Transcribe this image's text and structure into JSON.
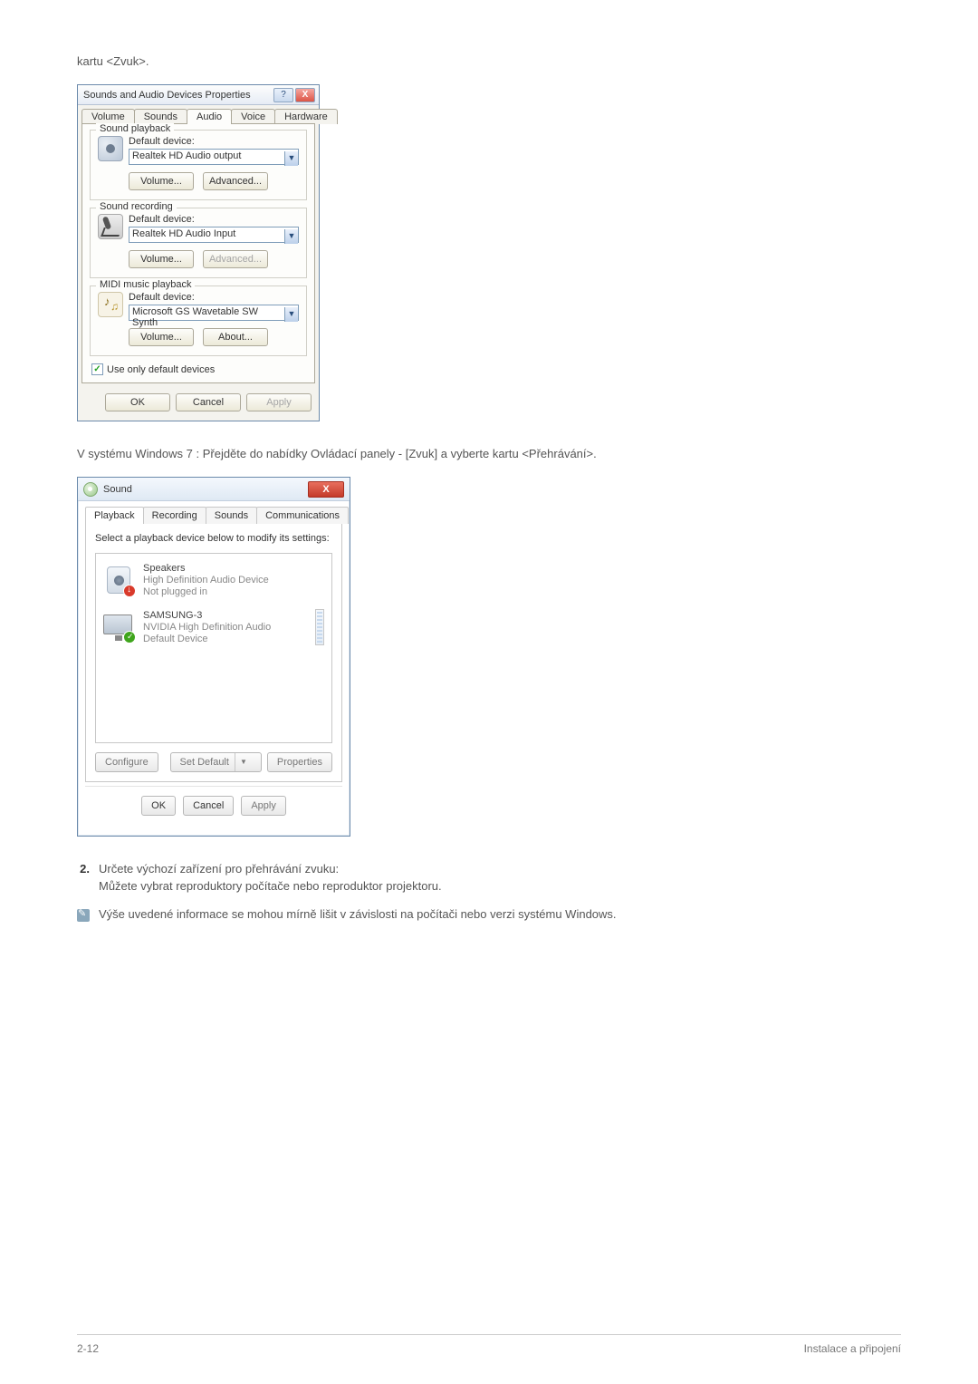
{
  "intro_text": "kartu <Zvuk>.",
  "xp": {
    "title": "Sounds and Audio Devices Properties",
    "tabs": {
      "t1": "Volume",
      "t2": "Sounds",
      "t3": "Audio",
      "t4": "Voice",
      "t5": "Hardware"
    },
    "playback": {
      "legend": "Sound playback",
      "label": "Default device:",
      "value": "Realtek HD Audio output",
      "btn_volume": "Volume...",
      "btn_advanced": "Advanced..."
    },
    "recording": {
      "legend": "Sound recording",
      "label": "Default device:",
      "value": "Realtek HD Audio Input",
      "btn_volume": "Volume...",
      "btn_advanced": "Advanced..."
    },
    "midi": {
      "legend": "MIDI music playback",
      "label": "Default device:",
      "value": "Microsoft GS Wavetable SW Synth",
      "btn_volume": "Volume...",
      "btn_about": "About..."
    },
    "checkbox": "Use only default devices",
    "btn_ok": "OK",
    "btn_cancel": "Cancel",
    "btn_apply": "Apply"
  },
  "mid_text": "V systému Windows 7 : Přejděte do nabídky Ovládací panely - [Zvuk] a vyberte kartu <Přehrávání>.",
  "w7": {
    "title": "Sound",
    "tabs": {
      "t1": "Playback",
      "t2": "Recording",
      "t3": "Sounds",
      "t4": "Communications"
    },
    "instruct": "Select a playback device below to modify its settings:",
    "dev1": {
      "name": "Speakers",
      "line2": "High Definition Audio Device",
      "line3": "Not plugged in"
    },
    "dev2": {
      "name": "SAMSUNG-3",
      "line2": "NVIDIA High Definition Audio",
      "line3": "Default Device"
    },
    "btn_configure": "Configure",
    "btn_setdefault": "Set Default",
    "btn_properties": "Properties",
    "btn_ok": "OK",
    "btn_cancel": "Cancel",
    "btn_apply": "Apply"
  },
  "step2_num": "2.",
  "step2_text": "Určete výchozí zařízení pro přehrávání zvuku:",
  "step2_sub": "Můžete vybrat reproduktory počítače nebo reproduktor projektoru.",
  "note_text": "Výše uvedené informace se mohou mírně lišit v závislosti na počítači nebo verzi systému Windows.",
  "footer_left": "2-12",
  "footer_right": "Instalace a připojení"
}
